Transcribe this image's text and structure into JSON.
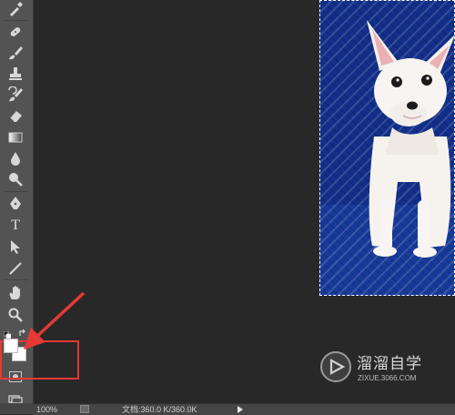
{
  "toolbar": {
    "tools": [
      {
        "name": "eyedropper-icon"
      },
      {
        "name": "healing-brush-icon"
      },
      {
        "name": "brush-icon"
      },
      {
        "name": "clone-stamp-icon"
      },
      {
        "name": "history-brush-icon"
      },
      {
        "name": "eraser-icon"
      },
      {
        "name": "gradient-icon"
      },
      {
        "name": "blur-icon"
      },
      {
        "name": "dodge-icon"
      },
      {
        "name": "pen-icon"
      },
      {
        "name": "type-icon",
        "label": "T"
      },
      {
        "name": "path-selection-icon"
      },
      {
        "name": "line-icon"
      },
      {
        "name": "hand-icon"
      },
      {
        "name": "zoom-icon"
      }
    ],
    "colors": {
      "foreground": "#ffffff",
      "background": "#ffffff"
    }
  },
  "canvas": {
    "background_color": "#122f8a",
    "subject": "white chihuahua on blue background with marching-ants selection"
  },
  "status_bar": {
    "zoom": "100%",
    "doc_info": "文档:360.0 K/360.0K"
  },
  "watermark": {
    "title": "溜溜自学",
    "url": "ZIXUE.3066.COM"
  }
}
